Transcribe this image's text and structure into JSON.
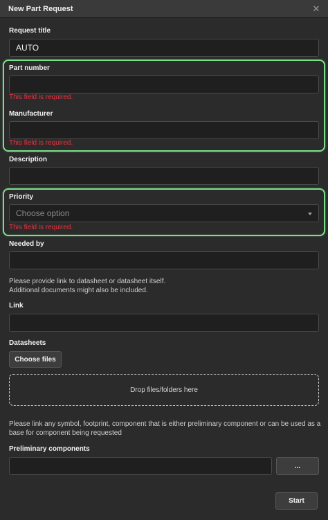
{
  "window": {
    "title": "New Part Request"
  },
  "form": {
    "request_title": {
      "label": "Request title",
      "value": "AUTO"
    },
    "part_number": {
      "label": "Part number",
      "value": "",
      "error": "This field is required."
    },
    "manufacturer": {
      "label": "Manufacturer",
      "value": "",
      "error": "This field is required."
    },
    "description": {
      "label": "Description",
      "value": ""
    },
    "priority": {
      "label": "Priority",
      "placeholder": "Choose option",
      "error": "This field is required."
    },
    "needed_by": {
      "label": "Needed by",
      "value": ""
    },
    "link_hint": {
      "line1": "Please provide link to datasheet or datasheet itself.",
      "line2": "Additional documents might also be included."
    },
    "link": {
      "label": "Link",
      "value": ""
    },
    "datasheets": {
      "label": "Datasheets",
      "choose_files_label": "Choose files",
      "dropzone_text": "Drop files/folders here"
    },
    "preliminary_hint": "Please link any symbol, footprint, component that is either preliminary component or can be used as a base for component being requested",
    "preliminary_components": {
      "label": "Preliminary components",
      "value": "",
      "browse_label": "..."
    }
  },
  "footer": {
    "start_label": "Start"
  },
  "colors": {
    "error": "#e8323e",
    "highlight": "#7ce08a",
    "background": "#2b2b2b",
    "input_bg": "#1f1f1f"
  }
}
